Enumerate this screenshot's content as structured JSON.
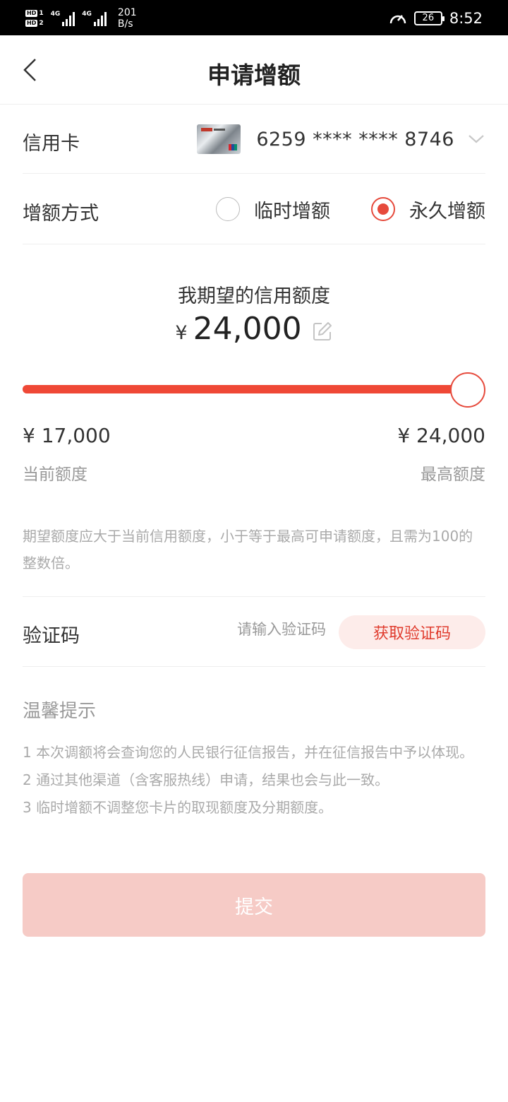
{
  "status_bar": {
    "sim1": "HD",
    "sim1_num": "1",
    "sim2": "HD",
    "sim2_num": "2",
    "net1": "4G",
    "net2": "4G",
    "speed_value": "201",
    "speed_unit": "B/s",
    "battery": "26",
    "time": "8:52"
  },
  "header": {
    "title": "申请增额"
  },
  "card": {
    "label": "信用卡",
    "number": "6259 **** **** 8746"
  },
  "method": {
    "label": "增额方式",
    "options": [
      {
        "label": "临时增额",
        "selected": false
      },
      {
        "label": "永久增额",
        "selected": true
      }
    ]
  },
  "expected": {
    "title": "我期望的信用额度",
    "currency": "¥",
    "amount": "24,000"
  },
  "slider": {
    "value_fraction": 1.0
  },
  "range": {
    "min_value": "¥ 17,000",
    "max_value": "¥ 24,000",
    "min_label": "当前额度",
    "max_label": "最高额度"
  },
  "rule_note": "期望额度应大于当前信用额度，小于等于最高可申请额度，且需为100的整数倍。",
  "verification": {
    "label": "验证码",
    "placeholder": "请输入验证码",
    "button": "获取验证码"
  },
  "tips": {
    "title": "温馨提示",
    "items": [
      "1  本次调额将会查询您的人民银行征信报告，并在征信报告中予以体现。",
      "2  通过其他渠道（含客服热线）申请，结果也会与此一致。",
      "3  临时增额不调整您卡片的取现额度及分期额度。"
    ]
  },
  "submit": {
    "label": "提交"
  },
  "colors": {
    "accent": "#e64a3c",
    "slider_fill": "#ef4836",
    "button_disabled": "#f6cbc6",
    "code_button_bg": "#fdecea"
  }
}
